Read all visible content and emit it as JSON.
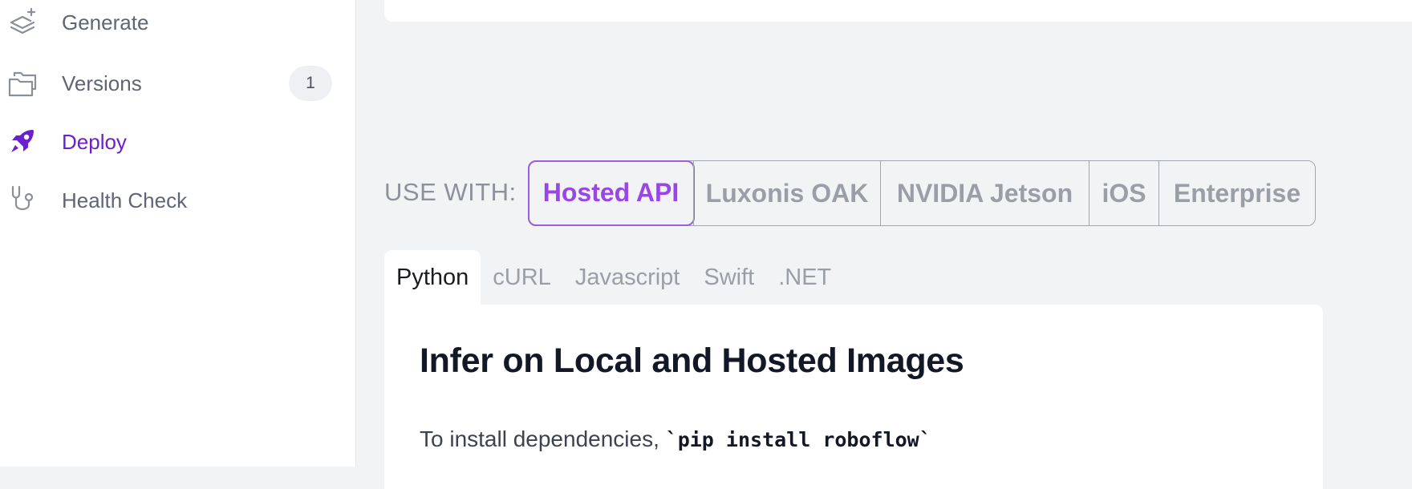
{
  "sidebar": {
    "items": [
      {
        "label": "Generate",
        "icon": "layers-plus-icon"
      },
      {
        "label": "Versions",
        "icon": "folders-icon",
        "badge": "1"
      },
      {
        "label": "Deploy",
        "icon": "rocket-icon",
        "active": true
      },
      {
        "label": "Health Check",
        "icon": "stethoscope-icon"
      }
    ]
  },
  "deploy": {
    "use_with_label": "USE WITH:",
    "platforms": [
      "Hosted API",
      "Luxonis OAK",
      "NVIDIA Jetson",
      "iOS",
      "Enterprise"
    ],
    "active_platform": "Hosted API",
    "language_tabs": [
      "Python",
      "cURL",
      "Javascript",
      "Swift",
      ".NET"
    ],
    "active_language": "Python",
    "content": {
      "title": "Infer on Local and Hosted Images",
      "install_text": "To install dependencies, ",
      "install_code": "`pip install roboflow`"
    }
  },
  "colors": {
    "accent_active": "#6a1fd0",
    "platform_active": "#9945e8",
    "sidebar_text": "#5f6573",
    "background": "#f2f3f5"
  }
}
